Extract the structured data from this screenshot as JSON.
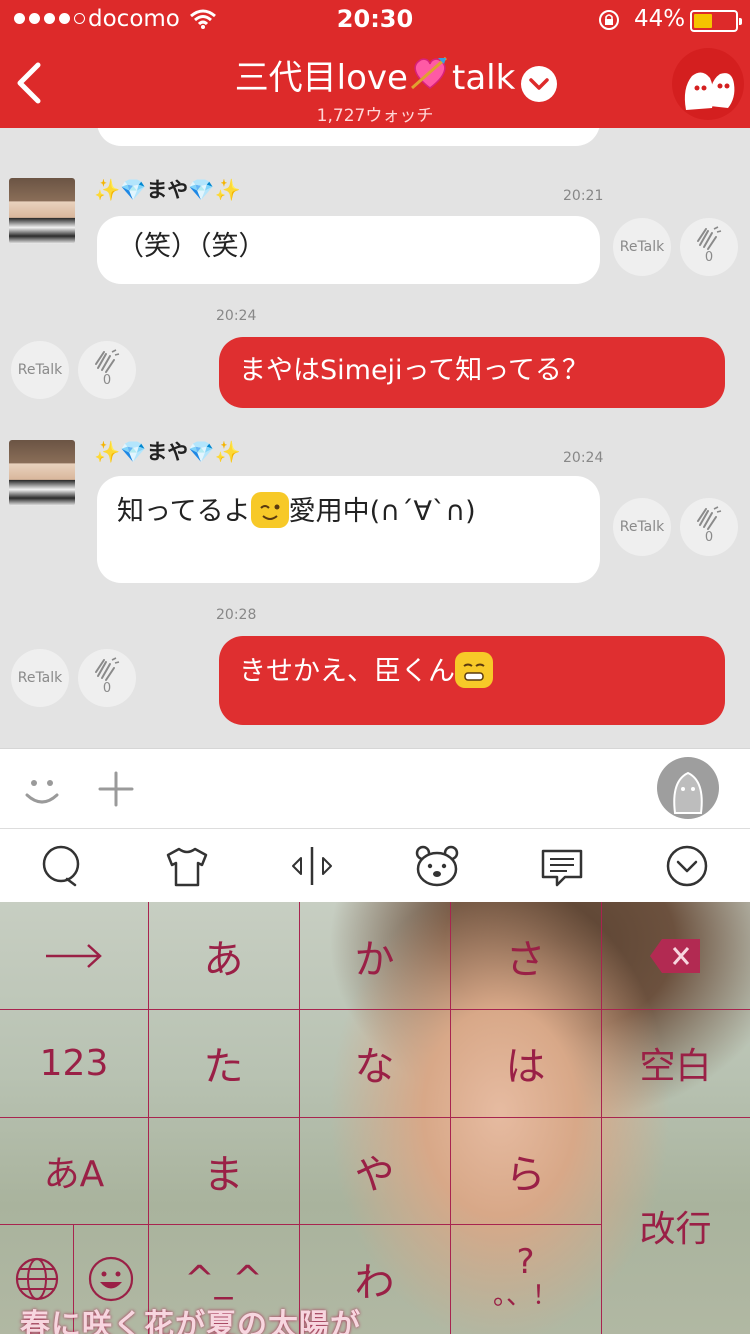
{
  "status_bar": {
    "carrier": "docomo",
    "time": "20:30",
    "battery": "44%",
    "battery_level": 0.44
  },
  "header": {
    "title_prefix": "三代目love",
    "title_suffix": "talk",
    "subtitle": "1,727ウォッチ"
  },
  "messages": [
    {
      "user": "まや",
      "time": "20:21",
      "text": "（笑）（笑）",
      "clap_count": "0",
      "retalk": "ReTalk"
    },
    {
      "time": "20:24",
      "text": "まやはSimejiって知ってる？",
      "clap_count": "0",
      "retalk": "ReTalk"
    },
    {
      "user": "まや",
      "time": "20:24",
      "text_before": "知ってるよ",
      "text_after": "愛用中(∩´∀`∩)",
      "clap_count": "0",
      "retalk": "ReTalk"
    },
    {
      "time": "20:28",
      "text": "きせかえ、臣くん",
      "clap_count": "0",
      "retalk": "ReTalk"
    }
  ],
  "keyboard": {
    "row1": [
      "→",
      "あ",
      "か",
      "さ"
    ],
    "row2": [
      "123",
      "た",
      "な",
      "は",
      "空白"
    ],
    "row3": [
      "あA",
      "ま",
      "や",
      "ら",
      "改行"
    ],
    "row4": [
      "^_^",
      "わ",
      "?",
      "。、！"
    ],
    "caption": "春に咲く花が夏の太陽が"
  },
  "colors": {
    "header": "#dd2a2a",
    "outgoing_bubble": "#df2f30",
    "key_text": "#9a2046"
  },
  "icons": [
    "back-icon",
    "dropdown-icon",
    "ghost-icon",
    "smiley-icon",
    "plus-icon",
    "clap-icon",
    "search-bubble-icon",
    "tshirt-icon",
    "cursor-icon",
    "bear-icon",
    "comment-icon",
    "chevron-down-icon",
    "backspace-icon",
    "globe-icon",
    "emoji-icon"
  ]
}
